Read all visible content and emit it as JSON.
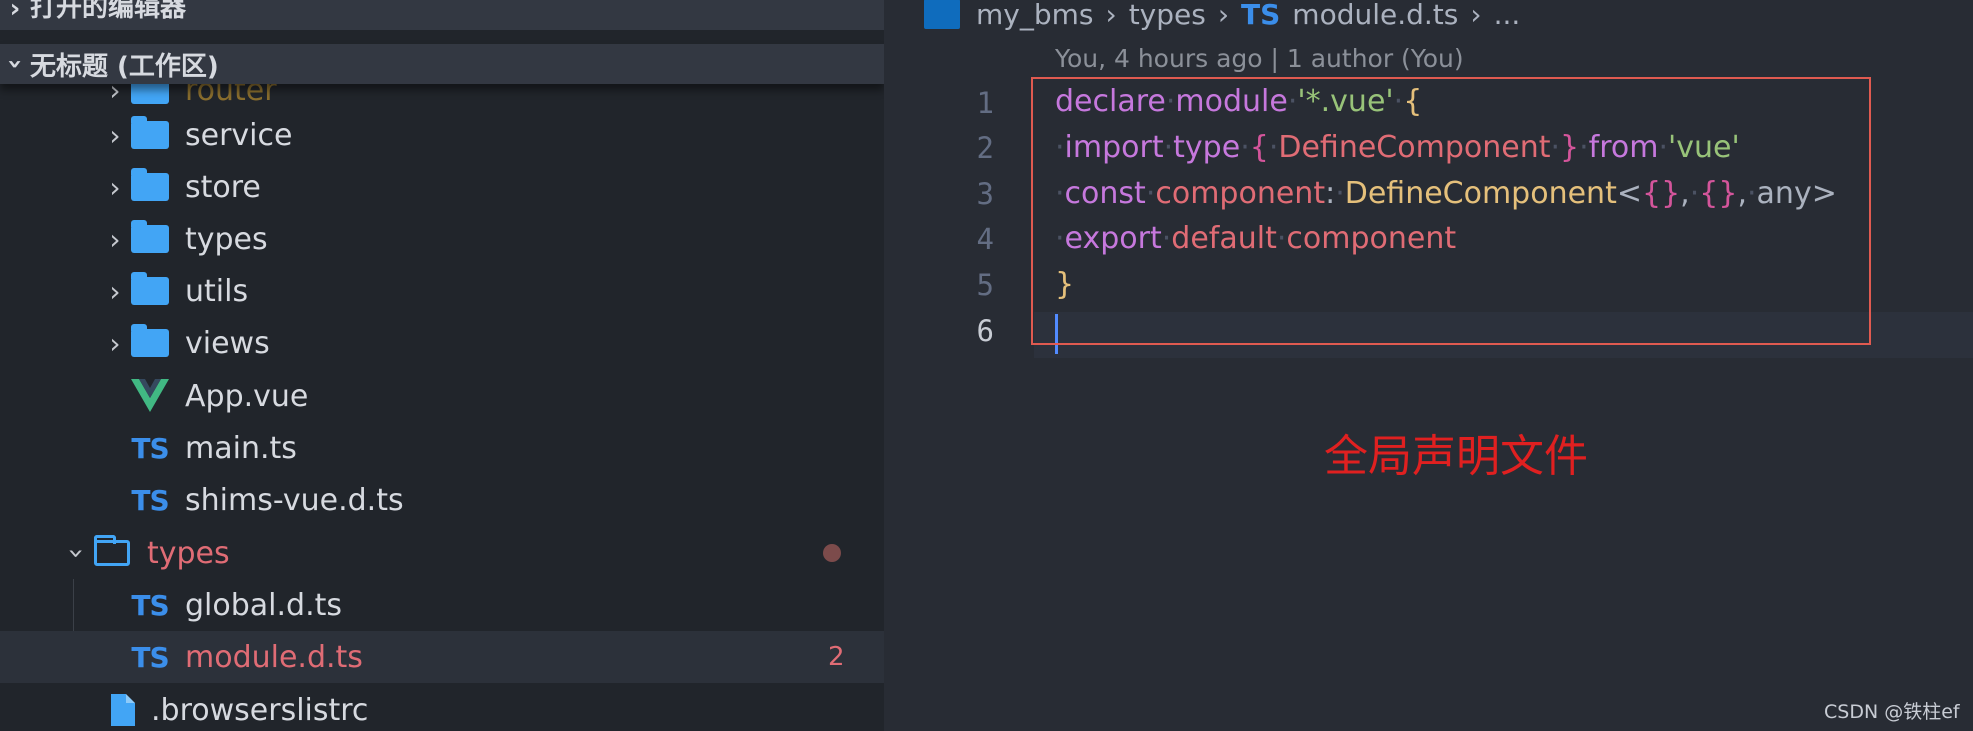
{
  "sidebar": {
    "open_editors_title": "打开的编辑器",
    "workspace_title": "无标题 (工作区)",
    "tree": [
      {
        "label": "router",
        "kind": "folder",
        "state": "partial"
      },
      {
        "label": "service",
        "kind": "folder"
      },
      {
        "label": "store",
        "kind": "folder"
      },
      {
        "label": "types",
        "kind": "folder"
      },
      {
        "label": "utils",
        "kind": "folder"
      },
      {
        "label": "views",
        "kind": "folder"
      },
      {
        "label": "App.vue",
        "kind": "vue-file"
      },
      {
        "label": "main.ts",
        "kind": "ts-file",
        "icon_text": "TS"
      },
      {
        "label": "shims-vue.d.ts",
        "kind": "ts-file",
        "icon_text": "TS"
      },
      {
        "label": "types",
        "kind": "folder-open",
        "modified": true
      },
      {
        "label": "global.d.ts",
        "kind": "ts-file",
        "icon_text": "TS"
      },
      {
        "label": "module.d.ts",
        "kind": "ts-file",
        "icon_text": "TS",
        "selected": true,
        "problems": "2"
      },
      {
        "label": ".browserslistrc",
        "kind": "file"
      }
    ]
  },
  "editor": {
    "breadcrumb": {
      "segments": [
        "my_bms",
        "types",
        "module.d.ts",
        "..."
      ],
      "ts_badge": "TS"
    },
    "codelens": "You, 4 hours ago | 1 author (You)",
    "line_numbers": [
      "1",
      "2",
      "3",
      "4",
      "5",
      "6"
    ],
    "code": {
      "l1": {
        "kw1": "declare",
        "kw2": "module",
        "str": "'*.vue'",
        "brace": "{"
      },
      "l2": {
        "kw1": "import",
        "kw2": "type",
        "ob": "{",
        "name": "DefineComponent",
        "cb": "}",
        "kw3": "from",
        "str": "'vue'"
      },
      "l3": {
        "kw": "const",
        "var": "component",
        "colon": ":",
        "type": "DefineComponent",
        "lt": "<",
        "a1": "{}",
        "comma1": ",",
        "a2": "{}",
        "comma2": ",",
        "a3": "any",
        "gt": ">"
      },
      "l4": {
        "kw": "export",
        "kw2": "default",
        "var": "component"
      },
      "l5": {
        "brace": "}"
      }
    },
    "annotation": "全局声明文件"
  },
  "watermark": "CSDN @铁柱ef",
  "colors": {
    "accent_highlight": "#e05a50",
    "annotation": "#e02020",
    "ts_icon": "#3b8eea",
    "folder_icon": "#42a5f5",
    "modified": "#e06c75"
  },
  "icons": {
    "folder": "folder-icon",
    "folder_open": "folder-open-icon",
    "ts": "typescript-icon",
    "vue": "vue-icon",
    "file": "file-icon",
    "chevron_right": "chevron-right-icon",
    "chevron_down": "chevron-down-icon"
  }
}
